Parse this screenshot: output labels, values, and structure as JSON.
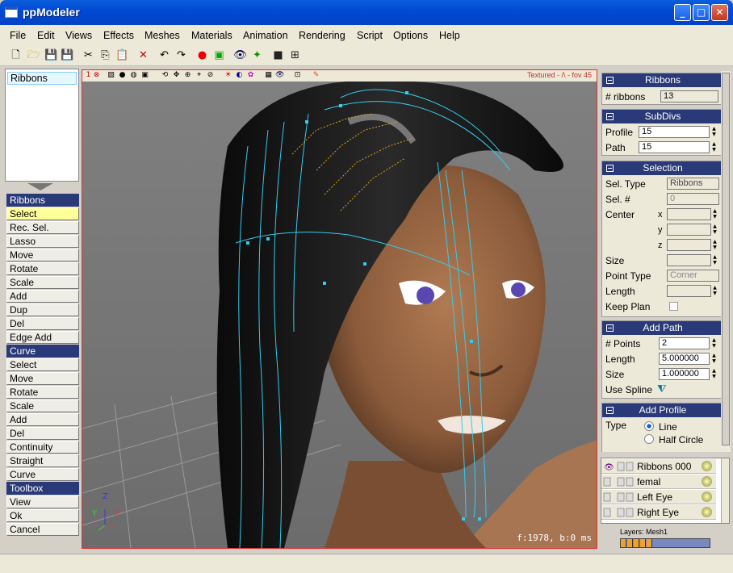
{
  "window": {
    "title": "ppModeler"
  },
  "menu": [
    "File",
    "Edit",
    "Views",
    "Effects",
    "Meshes",
    "Materials",
    "Animation",
    "Rendering",
    "Script",
    "Options",
    "Help"
  ],
  "object_list": {
    "selected": "Ribbons"
  },
  "left_buttons": {
    "ribbons_header": "Ribbons",
    "ribbons": [
      "Select",
      "Rec. Sel.",
      "Lasso",
      "Move",
      "Rotate",
      "Scale",
      "Add",
      "Dup",
      "Del",
      "Edge Add"
    ],
    "curve_header": "Curve",
    "curve": [
      "Select",
      "Move",
      "Rotate",
      "Scale",
      "Add",
      "Del",
      "Continuity",
      "Straight",
      "Curve"
    ],
    "toolbox_header": "Toolbox",
    "toolbox": [
      "View",
      "Ok",
      "Cancel"
    ]
  },
  "viewport": {
    "index": "1",
    "mode": "Textured - /\\ - fov 45",
    "stats": "f:1978, b:0 ms",
    "axis_z": "Z",
    "axis_y": "Y",
    "axis_x": "X"
  },
  "panels": {
    "ribbons": {
      "title": "Ribbons",
      "count_label": "# ribbons",
      "count_value": "13"
    },
    "subdivs": {
      "title": "SubDivs",
      "profile_label": "Profile",
      "profile_value": "15",
      "path_label": "Path",
      "path_value": "15"
    },
    "selection": {
      "title": "Selection",
      "seltype_label": "Sel. Type",
      "seltype_value": "Ribbons",
      "selnum_label": "Sel. #",
      "selnum_value": "0",
      "center_label": "Center",
      "x": "x",
      "y": "y",
      "z": "z",
      "size_label": "Size",
      "pointtype_label": "Point Type",
      "pointtype_value": "Corner",
      "length_label": "Length",
      "keepplan_label": "Keep Plan"
    },
    "addpath": {
      "title": "Add Path",
      "points_label": "# Points",
      "points_value": "2",
      "length_label": "Length",
      "length_value": "5.000000",
      "size_label": "Size",
      "size_value": "1.000000",
      "usespline_label": "Use Spline"
    },
    "addprofile": {
      "title": "Add Profile",
      "type_label": "Type",
      "opt_line": "Line",
      "opt_halfcircle": "Half Circle"
    }
  },
  "layers": {
    "rows": [
      "Ribbons 000",
      "femal",
      "Left Eye",
      "Right Eye"
    ],
    "status": "Layers: Mesh1"
  },
  "colors": {
    "header_blue": "#2a3a78",
    "select_yellow": "#ffff99",
    "curve_cyan": "#33ccee",
    "handle_orange": "#e0a020",
    "skin": "#9a6a48"
  }
}
